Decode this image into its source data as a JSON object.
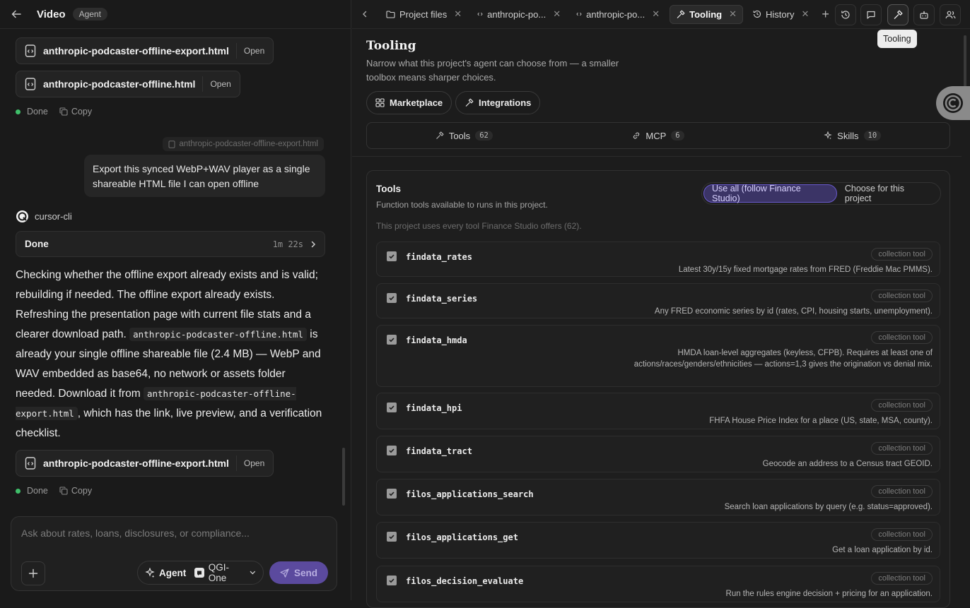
{
  "left": {
    "header": {
      "title": "Video",
      "badge": "Agent"
    },
    "files_top": [
      {
        "name": "anthropic-podcaster-offline-export.html",
        "open": "Open"
      },
      {
        "name": "anthropic-podcaster-offline.html",
        "open": "Open"
      }
    ],
    "status1": {
      "done": "Done",
      "copy": "Copy"
    },
    "context_tag": "anthropic-podcaster-offline-export.html",
    "user_message": "Export this synced WebP+WAV player as a single shareable HTML file I can open offline",
    "agent_name": "cursor-cli",
    "done_bar": {
      "label": "Done",
      "time": "1m 22s"
    },
    "reply": {
      "p1": "Checking whether the offline export already exists and is valid; rebuilding if needed. The offline export already exists. Refreshing the presentation page with current file stats and a clearer download path.",
      "code1": "anthropic-podcaster-offline.html",
      "p2": "is already your single offline shareable file (2.4 MB) — WebP and WAV embedded as base64, no network or assets folder needed. Download it from",
      "code2": "anthropic-podcaster-offline-export.html",
      "p3": ", which has the link, live preview, and a verification checklist."
    },
    "file_bottom": {
      "name": "anthropic-podcaster-offline-export.html",
      "open": "Open"
    },
    "status2": {
      "done": "Done",
      "copy": "Copy"
    },
    "composer": {
      "placeholder": "Ask about rates, loans, disclosures, or compliance...",
      "mode": "Agent",
      "model": "QGI-One",
      "send": "Send"
    }
  },
  "right": {
    "tabs": [
      {
        "label": "Project files"
      },
      {
        "label": "anthropic-po..."
      },
      {
        "label": "anthropic-po..."
      },
      {
        "label": "Tooling"
      },
      {
        "label": "History"
      }
    ],
    "tooltip": "Tooling",
    "heading": "Tooling",
    "subheading": "Narrow what this project's agent can choose from — a smaller toolbox means sharper choices.",
    "buttons": {
      "marketplace": "Marketplace",
      "integrations": "Integrations"
    },
    "segments": [
      {
        "label": "Tools",
        "count": "62"
      },
      {
        "label": "MCP",
        "count": "6"
      },
      {
        "label": "Skills",
        "count": "10"
      }
    ],
    "card": {
      "title": "Tools",
      "subtitle": "Function tools available to runs in this project.",
      "note": "This project uses every tool Finance Studio offers (62).",
      "toggle_all": "Use all (follow Finance Studio)",
      "toggle_choose": "Choose for this project"
    },
    "tools": [
      {
        "name": "findata_rates",
        "tag": "collection tool",
        "desc": "Latest 30y/15y fixed mortgage rates from FRED (Freddie Mac PMMS)."
      },
      {
        "name": "findata_series",
        "tag": "collection tool",
        "desc": "Any FRED economic series by id (rates, CPI, housing starts, unemployment)."
      },
      {
        "name": "findata_hmda",
        "tag": "collection tool",
        "desc": "HMDA loan-level aggregates (keyless, CFPB). Requires at least one of actions/races/genders/ethnicities — actions=1,3 gives the origination vs denial mix."
      },
      {
        "name": "findata_hpi",
        "tag": "collection tool",
        "desc": "FHFA House Price Index for a place (US, state, MSA, county)."
      },
      {
        "name": "findata_tract",
        "tag": "collection tool",
        "desc": "Geocode an address to a Census tract GEOID."
      },
      {
        "name": "filos_applications_search",
        "tag": "collection tool",
        "desc": "Search loan applications by query (e.g. status=approved)."
      },
      {
        "name": "filos_applications_get",
        "tag": "collection tool",
        "desc": "Get a loan application by id."
      },
      {
        "name": "filos_decision_evaluate",
        "tag": "collection tool",
        "desc": "Run the rules engine decision + pricing for an application."
      }
    ]
  }
}
